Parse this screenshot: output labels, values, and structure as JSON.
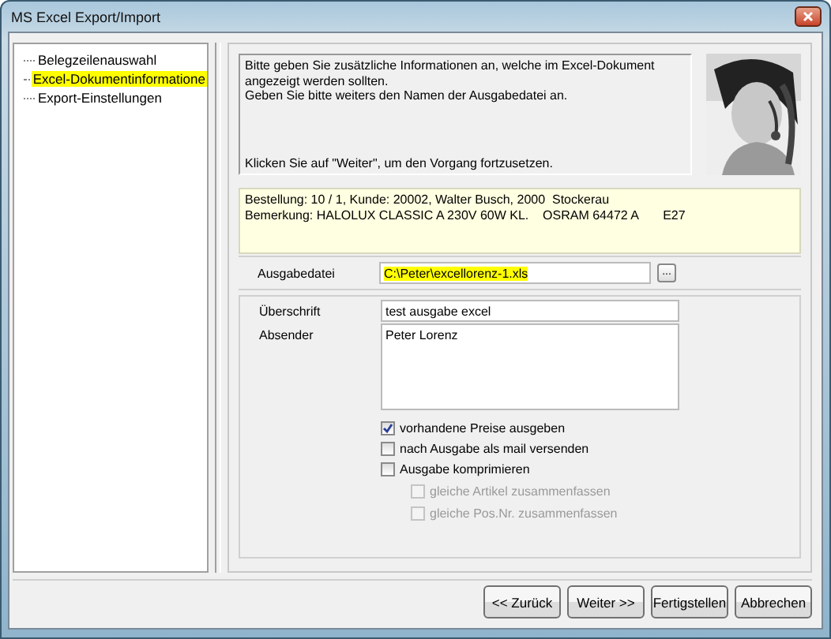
{
  "window": {
    "title": "MS Excel Export/Import"
  },
  "tree": {
    "items": [
      {
        "label": "Belegzeilenauswahl",
        "selected": false
      },
      {
        "label": "Excel-Dokumentinformatione",
        "selected": true
      },
      {
        "label": "Export-Einstellungen",
        "selected": false
      }
    ]
  },
  "info": {
    "lines": [
      "Bitte geben Sie zusätzliche Informationen an, welche im Excel-Dokument",
      "angezeigt werden sollten.",
      "Geben Sie bitte weiters den Namen der Ausgabedatei an."
    ],
    "hint": "Klicken Sie auf \"Weiter\", um den Vorgang fortzusetzen.",
    "photo": {
      "kind": "picture"
    }
  },
  "order_info": {
    "lines": [
      "Bestellung: 10 / 1, Kunde: 20002, Walter Busch, 2000  Stockerau",
      "Bemerkung: HALOLUX CLASSIC A 230V 60W KL.    OSRAM 64472 A       E27"
    ]
  },
  "output_file": {
    "label": "Ausgabedatei",
    "value": "C:\\Peter\\excellorenz-1.xls",
    "highlighted": true,
    "browse": "..."
  },
  "heading": {
    "label": "Überschrift",
    "value": "test ausgabe excel"
  },
  "sender": {
    "label": "Absender",
    "value": "Peter Lorenz"
  },
  "options": [
    {
      "label": "vorhandene Preise ausgeben",
      "checked": true,
      "disabled": false
    },
    {
      "label": "nach Ausgabe als mail versenden",
      "checked": false,
      "disabled": false
    },
    {
      "label": "Ausgabe komprimieren",
      "checked": false,
      "disabled": false,
      "children": [
        {
          "label": "gleiche Artikel zusammenfassen",
          "checked": false,
          "disabled": true
        },
        {
          "label": "gleiche Pos.Nr. zusammenfassen",
          "checked": false,
          "disabled": true
        }
      ]
    }
  ],
  "buttons": [
    "<< Zurück",
    "Weiter >>",
    "Fertigstellen",
    "Abbrechen"
  ]
}
